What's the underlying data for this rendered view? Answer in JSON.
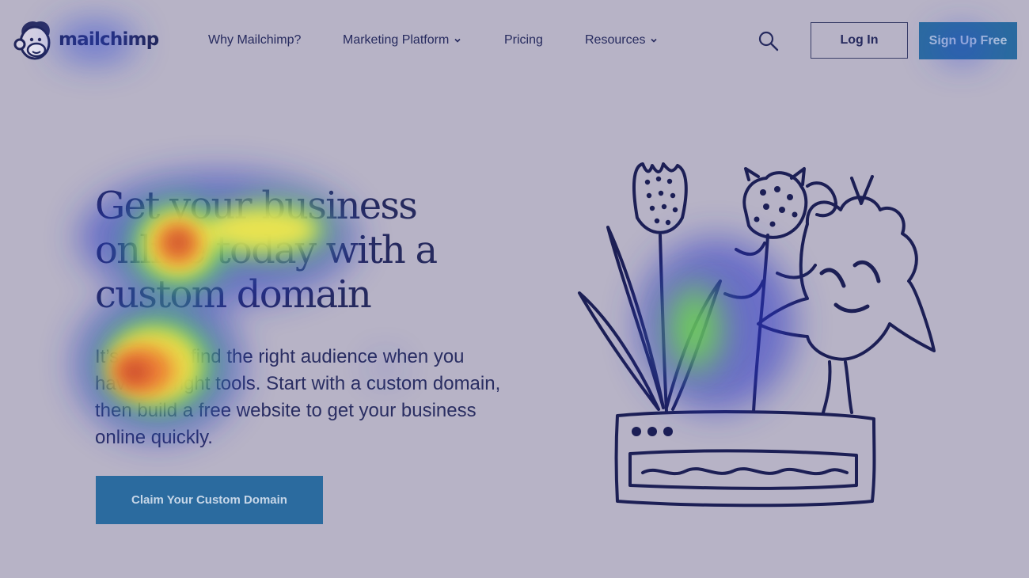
{
  "brand": {
    "name": "mailchimp",
    "logo_icon": "freddie-chimp-logo-icon"
  },
  "nav": {
    "items": [
      {
        "label": "Why Mailchimp?",
        "has_dropdown": false
      },
      {
        "label": "Marketing Platform",
        "has_dropdown": true
      },
      {
        "label": "Pricing",
        "has_dropdown": false
      },
      {
        "label": "Resources",
        "has_dropdown": true
      }
    ],
    "search_icon": "search-icon",
    "login_label": "Log In",
    "signup_label": "Sign Up Free"
  },
  "hero": {
    "title": "Get your business online today with a custom domain",
    "body": "It’s easy to find the right audience when you have the right tools. Start with a custom domain, then build a free website to get your business online quickly.",
    "cta_label": "Claim Your Custom Domain",
    "illustration": "flower-pot-illustration"
  },
  "heatmap_overlay": {
    "visible": true,
    "hotspots": [
      "mailchimp logo",
      "Sign Up Free button",
      "hero headline",
      "hero body text",
      "flower illustration leaves"
    ]
  },
  "colors": {
    "background": "#b7b3c6",
    "text": "#262a5e",
    "primary_button": "#2b6b9f",
    "primary_button_text": "#c7d7e8",
    "illustration_ink": "#1c1f55"
  }
}
